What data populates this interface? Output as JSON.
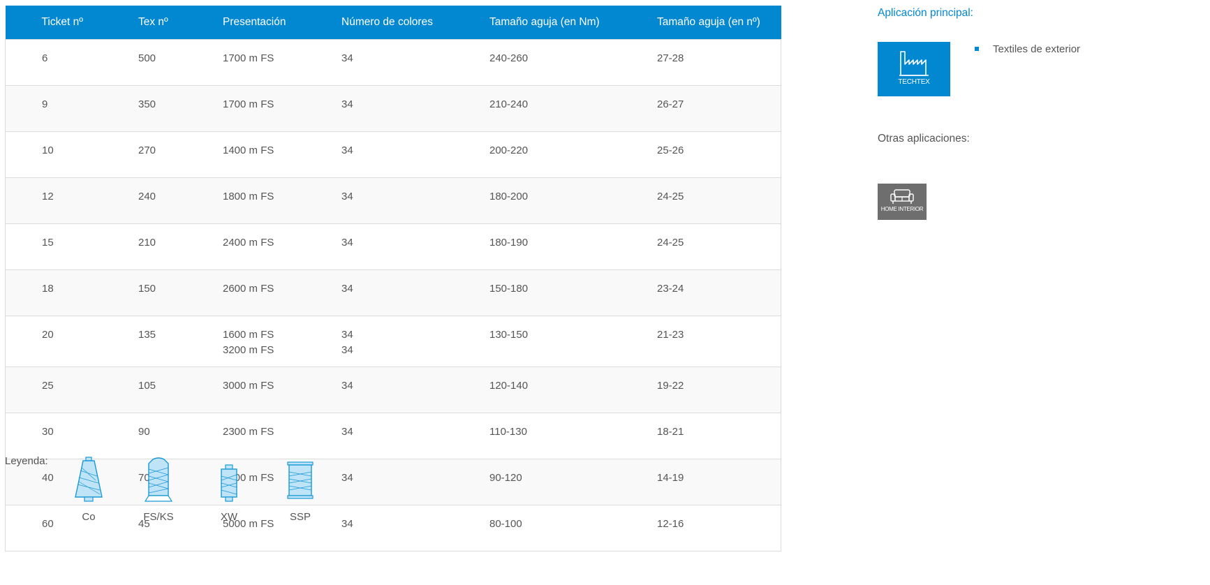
{
  "table": {
    "headers": [
      "Ticket nº",
      "Tex nº",
      "Presentación",
      "Número de colores",
      "Tamaño aguja (en Nm)",
      "Tamaño aguja (en nº)"
    ],
    "rows": [
      {
        "ticket": "6",
        "tex": "500",
        "presentacion": [
          "1700 m FS"
        ],
        "colores": [
          "34"
        ],
        "nm": "240-260",
        "no": "27-28"
      },
      {
        "ticket": "9",
        "tex": "350",
        "presentacion": [
          "1700 m FS"
        ],
        "colores": [
          "34"
        ],
        "nm": "210-240",
        "no": "26-27"
      },
      {
        "ticket": "10",
        "tex": "270",
        "presentacion": [
          "1400 m FS"
        ],
        "colores": [
          "34"
        ],
        "nm": "200-220",
        "no": "25-26"
      },
      {
        "ticket": "12",
        "tex": "240",
        "presentacion": [
          "1800 m FS"
        ],
        "colores": [
          "34"
        ],
        "nm": "180-200",
        "no": "24-25"
      },
      {
        "ticket": "15",
        "tex": "210",
        "presentacion": [
          "2400 m FS"
        ],
        "colores": [
          "34"
        ],
        "nm": "180-190",
        "no": "24-25"
      },
      {
        "ticket": "18",
        "tex": "150",
        "presentacion": [
          "2600 m FS"
        ],
        "colores": [
          "34"
        ],
        "nm": "150-180",
        "no": "23-24"
      },
      {
        "ticket": "20",
        "tex": "135",
        "presentacion": [
          "1600 m FS",
          "3200 m FS"
        ],
        "colores": [
          "34",
          "34"
        ],
        "nm": "130-150",
        "no": "21-23"
      },
      {
        "ticket": "25",
        "tex": "105",
        "presentacion": [
          "3000 m FS"
        ],
        "colores": [
          "34"
        ],
        "nm": "120-140",
        "no": "19-22"
      },
      {
        "ticket": "30",
        "tex": "90",
        "presentacion": [
          "2300 m FS"
        ],
        "colores": [
          "34"
        ],
        "nm": "110-130",
        "no": "18-21"
      },
      {
        "ticket": "40",
        "tex": "70",
        "presentacion": [
          "4600 m FS"
        ],
        "colores": [
          "34"
        ],
        "nm": "90-120",
        "no": "14-19"
      },
      {
        "ticket": "60",
        "tex": "45",
        "presentacion": [
          "5000 m FS"
        ],
        "colores": [
          "34"
        ],
        "nm": "80-100",
        "no": "12-16"
      }
    ]
  },
  "legend": {
    "label": "Leyenda:",
    "items": [
      {
        "caption": "Co",
        "icon": "cone-spool-icon"
      },
      {
        "caption": "FS/KS",
        "icon": "king-spool-icon"
      },
      {
        "caption": "XW",
        "icon": "small-spool-icon"
      },
      {
        "caption": "SSP",
        "icon": "cylinder-spool-icon"
      }
    ]
  },
  "sidebar": {
    "main_title": "Aplicación principal:",
    "main_tile": {
      "caption": "TECHTEX",
      "icon": "factory-icon",
      "color": "#0288d1"
    },
    "main_items": [
      "Textiles de exterior"
    ],
    "other_title": "Otras aplicaciones:",
    "other_tile": {
      "caption": "HOME INTERIOR",
      "icon": "sofa-icon",
      "color": "#6e6e6e"
    }
  },
  "colors": {
    "accent": "#0288d1",
    "text": "#555555",
    "border": "#dcdcdc"
  }
}
